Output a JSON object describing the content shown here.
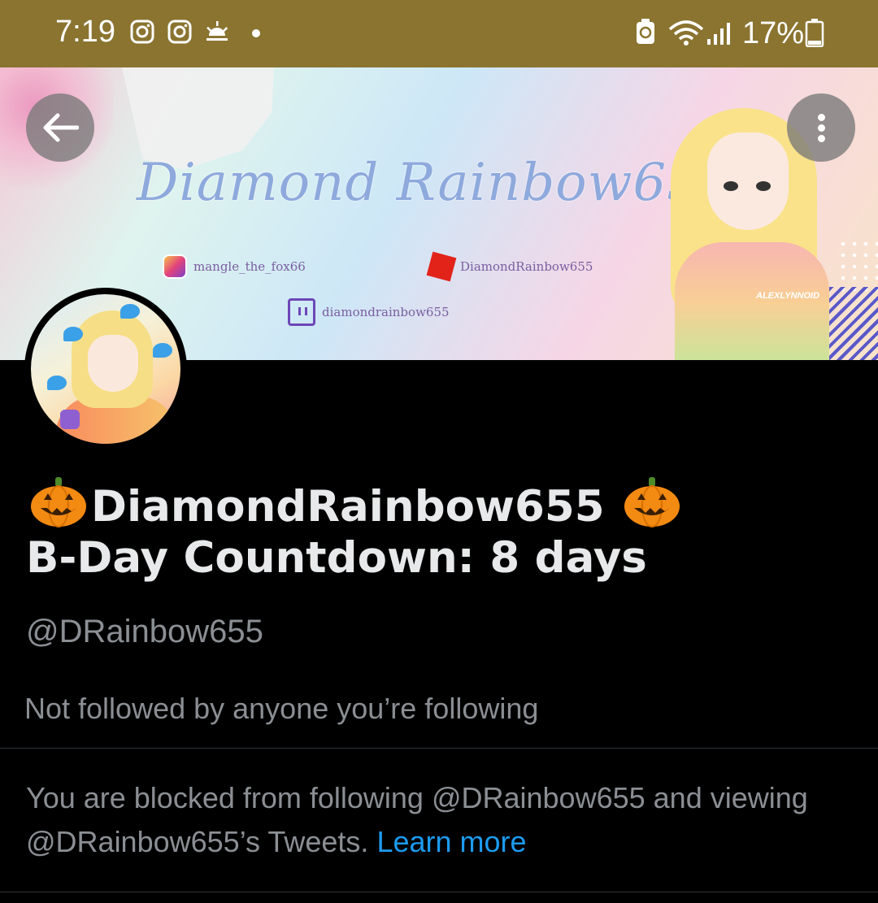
{
  "status_bar": {
    "time": "7:19",
    "battery": "17%"
  },
  "banner": {
    "title": "Diamond Rainbow655",
    "instagram": "mangle_the_fox66",
    "roblox": "DiamondRainbow655",
    "twitch": "diamondrainbow655",
    "artist_tag": "ALEXLYNNOID"
  },
  "profile": {
    "display_name_line1": "DiamondRainbow655",
    "display_name_line2": "B-Day Countdown: 8 days",
    "handle": "@DRainbow655",
    "followed_by": "Not followed by anyone you’re following",
    "blocked_message": "You are blocked from following @DRainbow655 and viewing @DRainbow655’s Tweets.",
    "learn_more": "Learn more"
  },
  "icons": {
    "back": "arrow-left-icon",
    "more": "more-vertical-icon",
    "emoji": "jack-o-lantern-icon"
  },
  "colors": {
    "status_bar": "#8a7430",
    "link": "#1d9bf0",
    "muted_text": "#8b8f94",
    "primary_text": "#e7e9ea"
  }
}
